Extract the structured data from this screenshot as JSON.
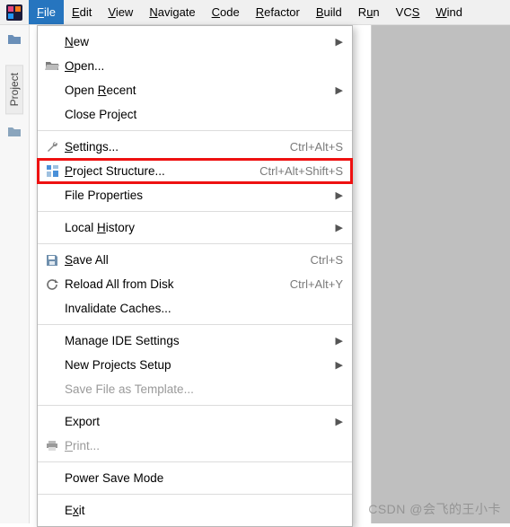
{
  "menubar": {
    "items": [
      {
        "label": "File",
        "mnemonic": "F",
        "active": true
      },
      {
        "label": "Edit",
        "mnemonic": "E"
      },
      {
        "label": "View",
        "mnemonic": "V"
      },
      {
        "label": "Navigate",
        "mnemonic": "N"
      },
      {
        "label": "Code",
        "mnemonic": "C"
      },
      {
        "label": "Refactor",
        "mnemonic": "R"
      },
      {
        "label": "Build",
        "mnemonic": "B"
      },
      {
        "label": "Run",
        "mnemonic": "u",
        "raw": "Run"
      },
      {
        "label": "VCS",
        "mnemonic": "S",
        "raw": "VCS"
      },
      {
        "label": "Window",
        "mnemonic": "W",
        "raw": "Wind"
      }
    ]
  },
  "sidebar": {
    "project_label": "Project"
  },
  "file_menu": {
    "items": [
      {
        "label": "New",
        "mnemonic": "N",
        "submenu": true
      },
      {
        "label": "Open...",
        "mnemonic": "O",
        "icon": "folder-open"
      },
      {
        "label": "Open Recent",
        "mnemonic": "R",
        "submenu": true
      },
      {
        "label": "Close Project",
        "mnemonic": "J"
      },
      {
        "sep": true
      },
      {
        "label": "Settings...",
        "mnemonic": "S",
        "icon": "wrench",
        "shortcut": "Ctrl+Alt+S"
      },
      {
        "label": "Project Structure...",
        "mnemonic": "P",
        "icon": "project-structure",
        "shortcut": "Ctrl+Alt+Shift+S",
        "highlight": true
      },
      {
        "label": "File Properties",
        "submenu": true
      },
      {
        "sep": true
      },
      {
        "label": "Local History",
        "mnemonic": "H",
        "submenu": true
      },
      {
        "sep": true
      },
      {
        "label": "Save All",
        "mnemonic": "S",
        "icon": "save",
        "shortcut": "Ctrl+S"
      },
      {
        "label": "Reload All from Disk",
        "icon": "reload",
        "shortcut": "Ctrl+Alt+Y"
      },
      {
        "label": "Invalidate Caches..."
      },
      {
        "sep": true
      },
      {
        "label": "Manage IDE Settings",
        "submenu": true
      },
      {
        "label": "New Projects Setup",
        "submenu": true
      },
      {
        "label": "Save File as Template...",
        "disabled": true
      },
      {
        "sep": true
      },
      {
        "label": "Export",
        "submenu": true
      },
      {
        "label": "Print...",
        "mnemonic": "P",
        "icon": "print",
        "disabled": true
      },
      {
        "sep": true
      },
      {
        "label": "Power Save Mode"
      },
      {
        "sep": true
      },
      {
        "label": "Exit",
        "mnemonic": "x"
      }
    ]
  },
  "watermark": "CSDN @会飞的王小卡"
}
